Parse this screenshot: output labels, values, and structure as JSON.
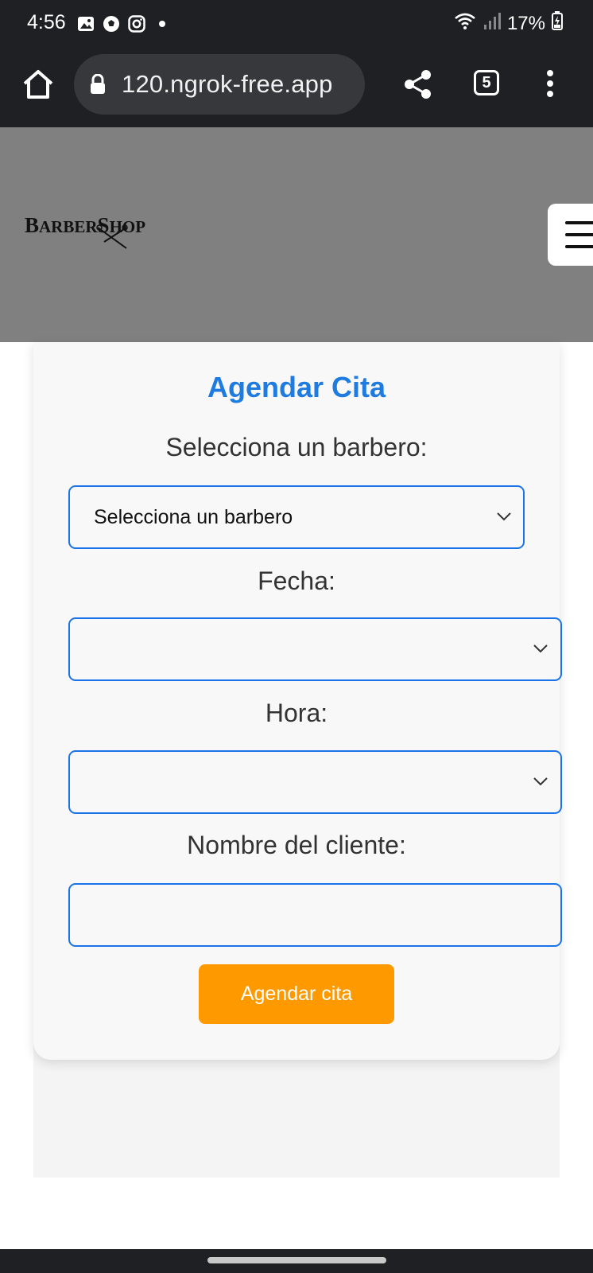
{
  "status_bar": {
    "time": "4:56",
    "battery": "17%",
    "icons": [
      "gallery-icon",
      "soccer-ball-icon",
      "instagram-icon",
      "notification-dot",
      "wifi-icon",
      "signal-icon",
      "battery-charging-icon"
    ]
  },
  "browser": {
    "url": "120.ngrok-free.app",
    "tab_count": "5",
    "icons": [
      "home-icon",
      "lock-icon",
      "share-icon",
      "tab-switcher-icon",
      "more-menu-icon"
    ]
  },
  "site": {
    "logo_text": "BARBERSHOP",
    "header_bg": "#808080",
    "menu_icon": "hamburger-icon"
  },
  "form": {
    "title": "Agendar Cita",
    "barber_label": "Selecciona un barbero:",
    "barber_selected": "Selecciona un barbero",
    "date_label": "Fecha:",
    "date_value": "",
    "time_label": "Hora:",
    "time_value": "",
    "client_label": "Nombre del cliente:",
    "client_value": "",
    "submit_label": "Agendar cita"
  },
  "colors": {
    "accent_blue": "#1e7be0",
    "input_border": "#1a73e8",
    "button_orange": "#fe9a00"
  }
}
